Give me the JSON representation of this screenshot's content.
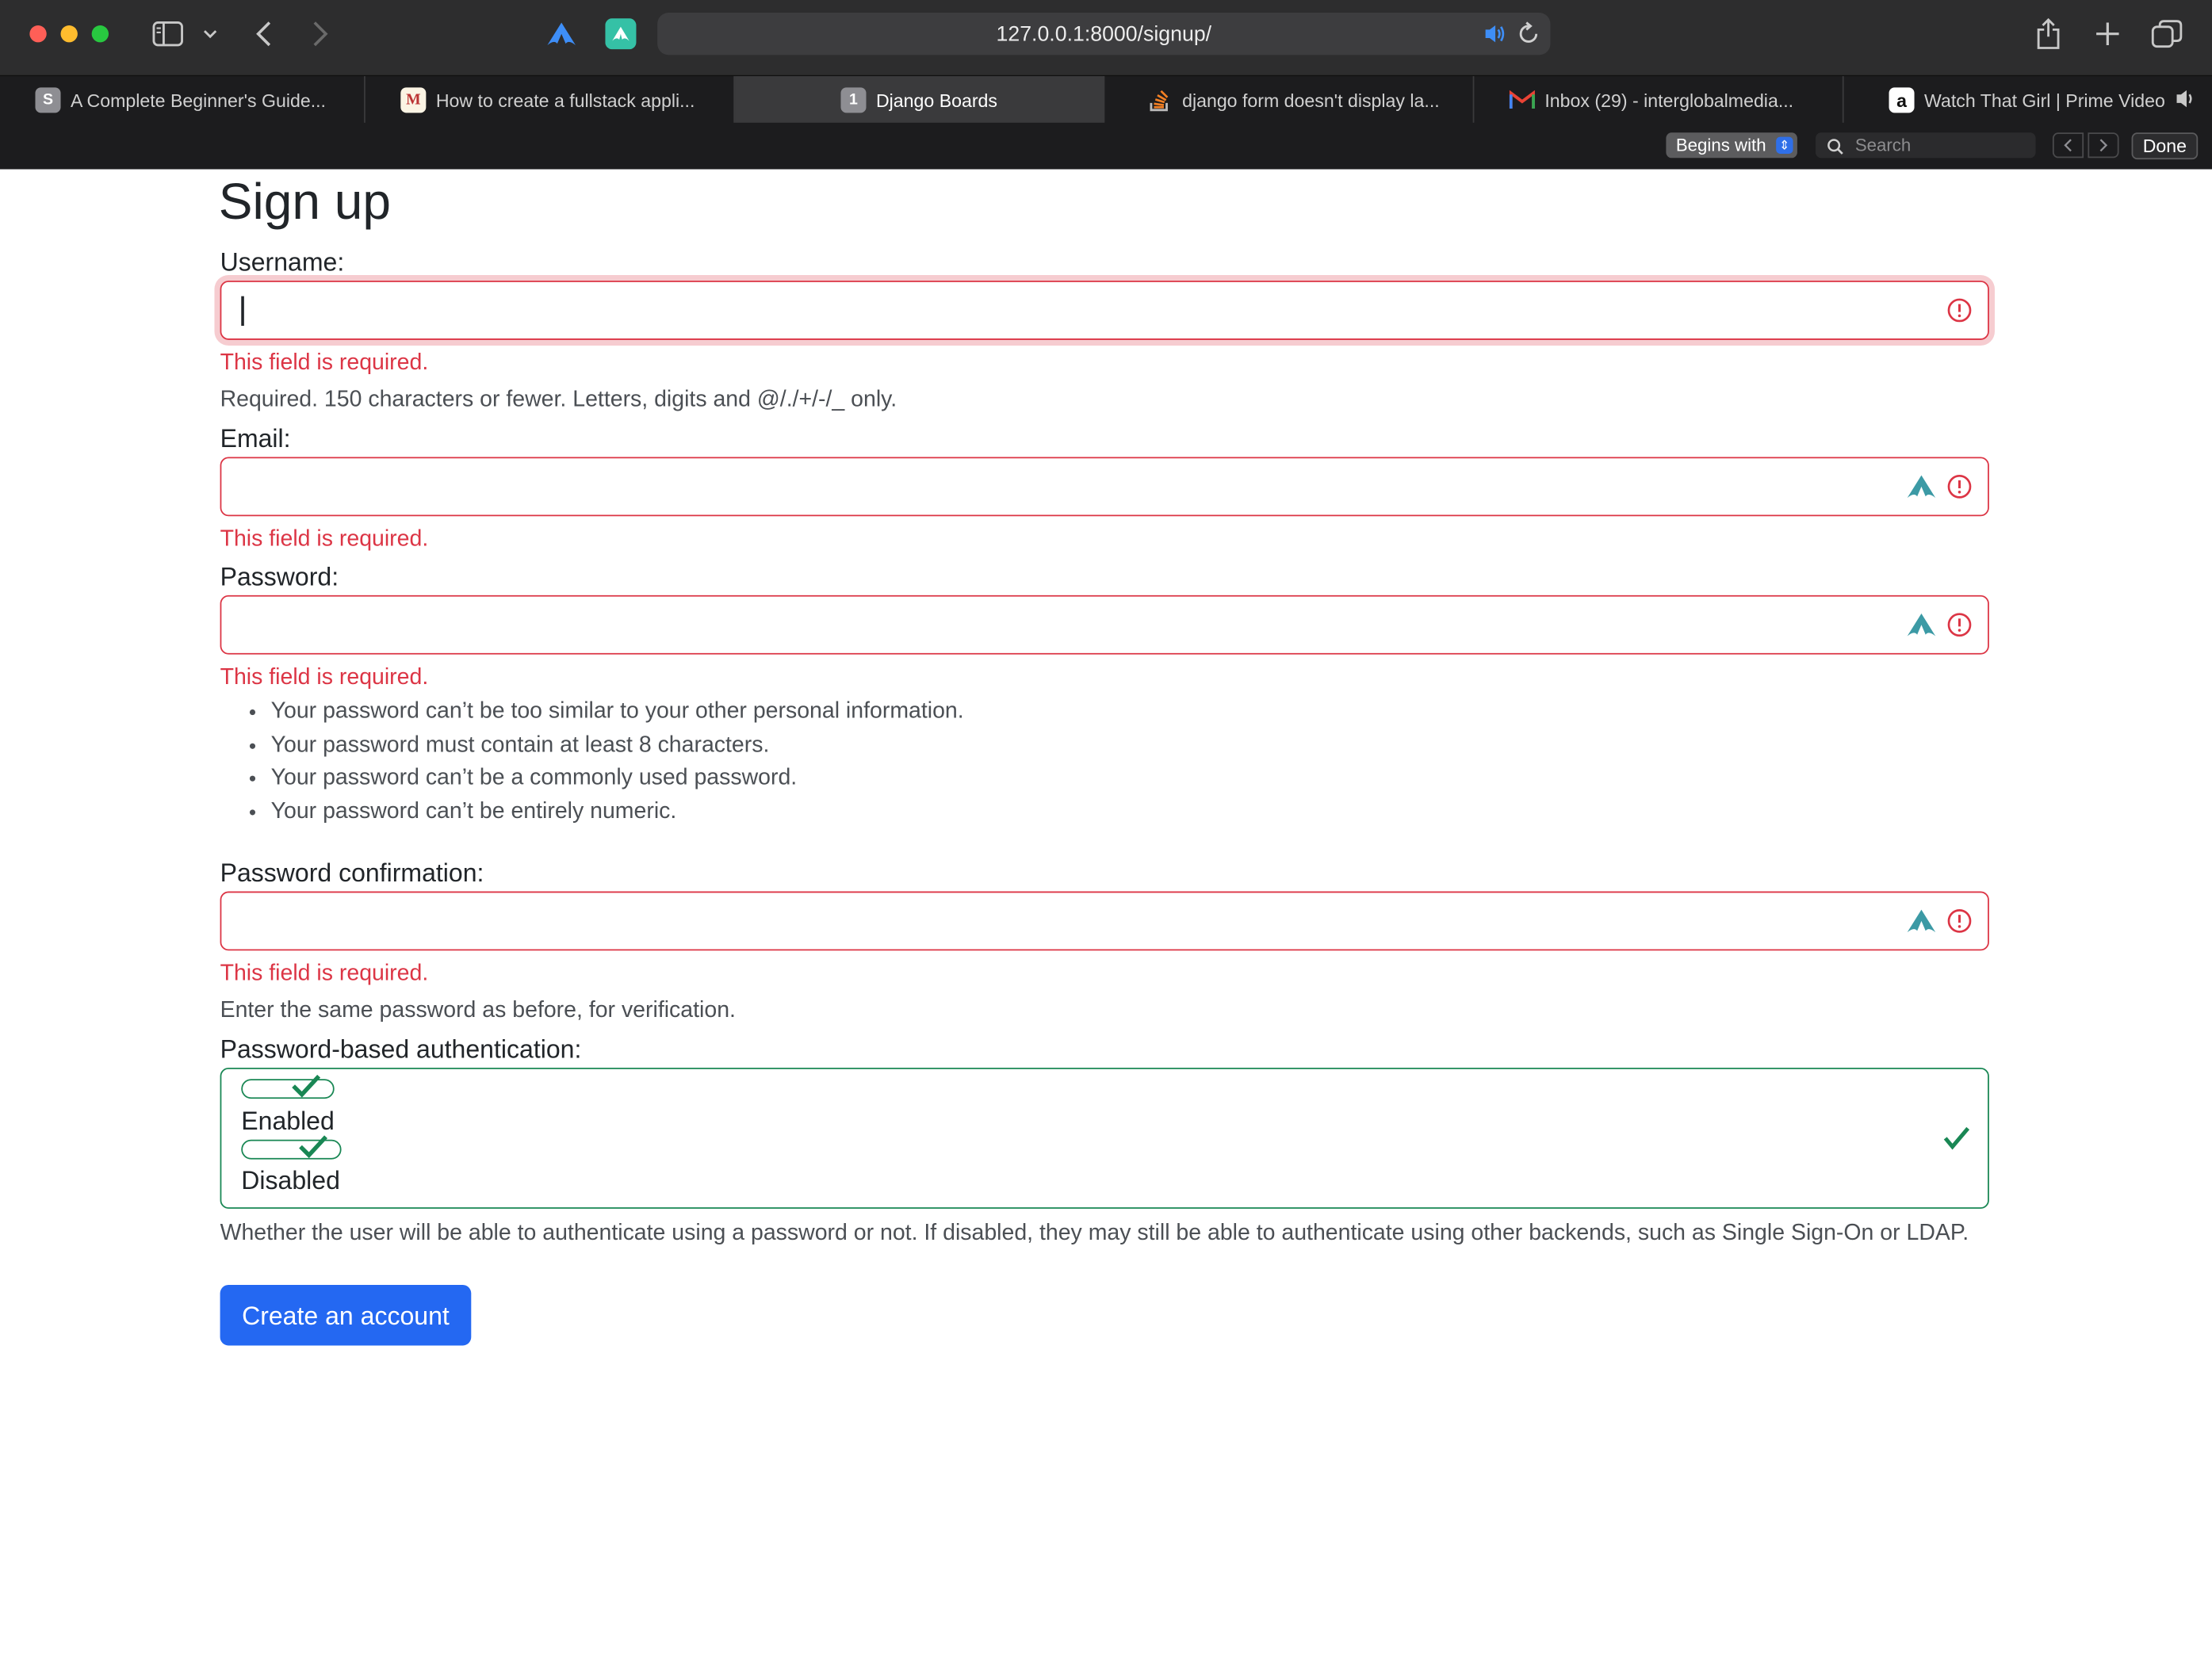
{
  "browser": {
    "url": "127.0.0.1:8000/signup/",
    "tabs": [
      {
        "label": "A Complete Beginner's Guide...",
        "favicon": "S"
      },
      {
        "label": "How to create a fullstack appli...",
        "favicon": "M"
      },
      {
        "label": "Django Boards",
        "favicon": "1"
      },
      {
        "label": "django form doesn't display la...",
        "favicon": "stackoverflow-icon"
      },
      {
        "label": "Inbox (29) - interglobalmedia...",
        "favicon": "M"
      },
      {
        "label": "Watch That Girl | Prime Video",
        "favicon": "a"
      }
    ],
    "find": {
      "mode": "Begins with",
      "placeholder": "Search",
      "done_label": "Done"
    }
  },
  "page": {
    "title": "Sign up",
    "username": {
      "label": "Username:",
      "value": "",
      "error": "This field is required.",
      "help": "Required. 150 characters or fewer. Letters, digits and @/./+/-/_ only."
    },
    "email": {
      "label": "Email:",
      "value": "",
      "error": "This field is required."
    },
    "password": {
      "label": "Password:",
      "value": "",
      "error": "This field is required.",
      "rules": [
        "Your password can’t be too similar to your other personal information.",
        "Your password must contain at least 8 characters.",
        "Your password can’t be a commonly used password.",
        "Your password can’t be entirely numeric."
      ]
    },
    "password_confirmation": {
      "label": "Password confirmation:",
      "value": "",
      "error": "This field is required.",
      "help": "Enter the same password as before, for verification."
    },
    "password_auth": {
      "label": "Password-based authentication:",
      "options": [
        "Enabled",
        "Disabled"
      ],
      "help": "Whether the user will be able to authenticate using a password or not. If disabled, they may still be able to authenticate using other backends, such as Single Sign-On or LDAP."
    },
    "submit_label": "Create an account"
  },
  "colors": {
    "error": "#dc3545",
    "valid": "#198754",
    "primary": "#2468f2",
    "chrome_dark": "#2d2d2e"
  }
}
